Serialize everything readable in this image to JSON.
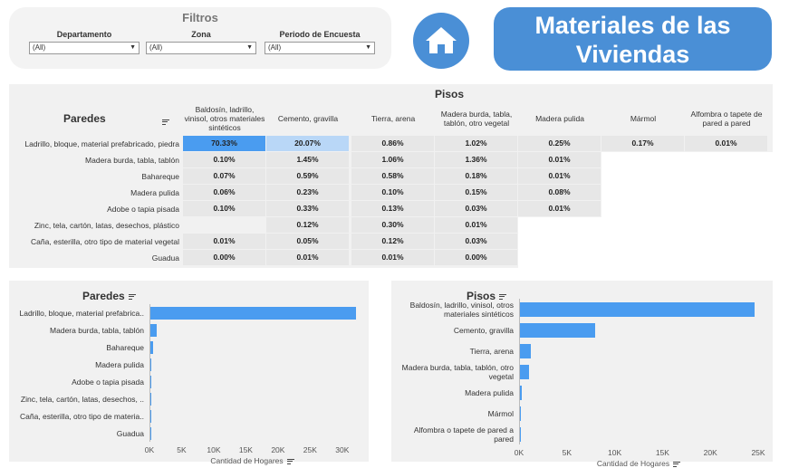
{
  "filters": {
    "title": "Filtros",
    "items": [
      {
        "label": "Departamento",
        "value": "(All)"
      },
      {
        "label": "Zona",
        "value": "(All)"
      },
      {
        "label": "Periodo de Encuesta",
        "value": "(All)"
      }
    ]
  },
  "banner": {
    "line1": "Materiales de las",
    "line2": "Viviendas"
  },
  "matrix": {
    "row_title": "Paredes",
    "col_title": "Pisos",
    "columns": [
      "Baldosín, ladrillo, vinisol, otros materiales sintéticos",
      "Cemento, gravilla",
      "Tierra, arena",
      "Madera burda, tabla, tablón, otro vegetal",
      "Madera pulida",
      "Mármol",
      "Alfombra o tapete de pared a pared"
    ],
    "rows": [
      {
        "label": "Ladrillo, bloque, material prefabricado, piedra",
        "values": [
          "70.33%",
          "20.07%",
          "0.86%",
          "1.02%",
          "0.25%",
          "0.17%",
          "0.01%"
        ]
      },
      {
        "label": "Madera burda, tabla, tablón",
        "values": [
          "0.10%",
          "1.45%",
          "1.06%",
          "1.36%",
          "0.01%",
          "",
          ""
        ]
      },
      {
        "label": "Bahareque",
        "values": [
          "0.07%",
          "0.59%",
          "0.58%",
          "0.18%",
          "0.01%",
          "",
          ""
        ]
      },
      {
        "label": "Madera pulida",
        "values": [
          "0.06%",
          "0.23%",
          "0.10%",
          "0.15%",
          "0.08%",
          "",
          ""
        ]
      },
      {
        "label": "Adobe o tapia pisada",
        "values": [
          "0.10%",
          "0.33%",
          "0.13%",
          "0.03%",
          "0.01%",
          "",
          ""
        ]
      },
      {
        "label": "Zinc, tela, cartón, latas, desechos, plástico",
        "values": [
          "",
          "0.12%",
          "0.30%",
          "0.01%",
          "",
          "",
          ""
        ]
      },
      {
        "label": "Caña, esterilla, otro tipo de material vegetal",
        "values": [
          "0.01%",
          "0.05%",
          "0.12%",
          "0.03%",
          "",
          "",
          ""
        ]
      },
      {
        "label": "Guadua",
        "values": [
          "0.00%",
          "0.01%",
          "0.01%",
          "0.00%",
          "",
          "",
          ""
        ]
      }
    ],
    "highlight_color_strong": "#4a9cf0",
    "highlight_color_light": "#b9d7f7"
  },
  "chart_data": [
    {
      "type": "bar",
      "orientation": "horizontal",
      "title": "Paredes",
      "xlabel": "Cantidad de Hogares",
      "categories": [
        "Ladrillo, bloque, material prefabrica..",
        "Madera burda, tabla, tablón",
        "Bahareque",
        "Madera pulida",
        "Adobe o tapia pisada",
        "Zinc, tela, cartón, latas, desechos, ..",
        "Caña, esterilla, otro tipo de materia..",
        "Guadua"
      ],
      "values": [
        32000,
        1000,
        400,
        150,
        150,
        60,
        50,
        10
      ],
      "xlim": [
        0,
        32000
      ],
      "xticks": [
        "0K",
        "5K",
        "10K",
        "15K",
        "20K",
        "25K",
        "30K"
      ],
      "color": "#4a9cf0"
    },
    {
      "type": "bar",
      "orientation": "horizontal",
      "title": "Pisos",
      "xlabel": "Cantidad de Hogares",
      "categories": [
        "Baldosín, ladrillo, vinisol, otros materiales sintéticos",
        "Cemento, gravilla",
        "Tierra, arena",
        "Madera burda, tabla, tablón, otro vegetal",
        "Madera pulida",
        "Mármol",
        "Alfombra o tapete de pared a pared"
      ],
      "values": [
        24500,
        7900,
        1100,
        900,
        200,
        90,
        5
      ],
      "xlim": [
        0,
        25000
      ],
      "xticks": [
        "0K",
        "5K",
        "10K",
        "15K",
        "20K",
        "25K"
      ],
      "color": "#4a9cf0"
    }
  ]
}
